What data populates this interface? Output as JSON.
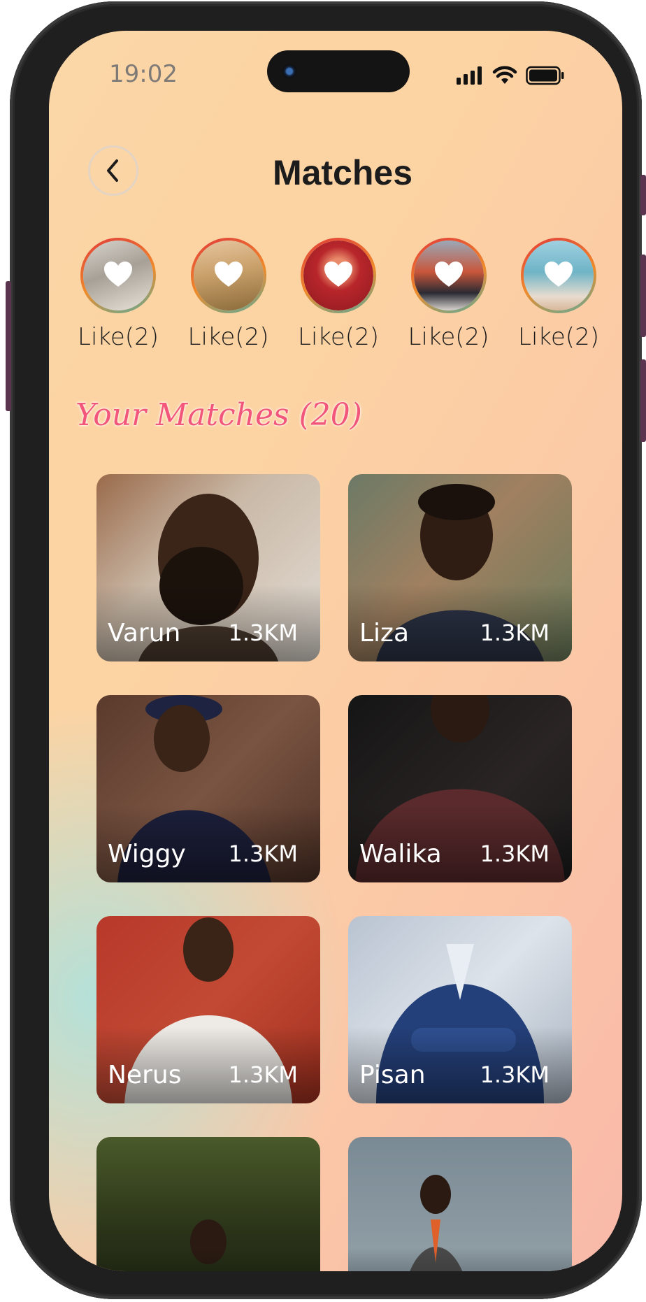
{
  "status_bar": {
    "time": "19:02"
  },
  "header": {
    "title": "Matches"
  },
  "likes": [
    {
      "label": "Like(2)",
      "tone": "#b9b2a8"
    },
    {
      "label": "Like(2)",
      "tone": "#c9a06a"
    },
    {
      "label": "Like(2)",
      "tone": "#b8262b"
    },
    {
      "label": "Like(2)",
      "tone": "#5e6d82"
    },
    {
      "label": "Like(2)",
      "tone": "#6fb4c7"
    }
  ],
  "section": {
    "title": "Your Matches (20)"
  },
  "matches": [
    {
      "name": "Varun",
      "distance": "1.3KM"
    },
    {
      "name": "Liza",
      "distance": "1.3KM"
    },
    {
      "name": "Wiggy",
      "distance": "1.3KM"
    },
    {
      "name": "Walika",
      "distance": "1.3KM"
    },
    {
      "name": "Nerus",
      "distance": "1.3KM"
    },
    {
      "name": "Pisan",
      "distance": "1.3KM"
    },
    {
      "name": "",
      "distance": ""
    },
    {
      "name": "",
      "distance": ""
    }
  ],
  "colors": {
    "accent_pink": "#f2567a",
    "title_text": "#1c1c1c",
    "ring_gradient": [
      "#e23a3a",
      "#ef8b2a",
      "#5bab9a"
    ]
  }
}
